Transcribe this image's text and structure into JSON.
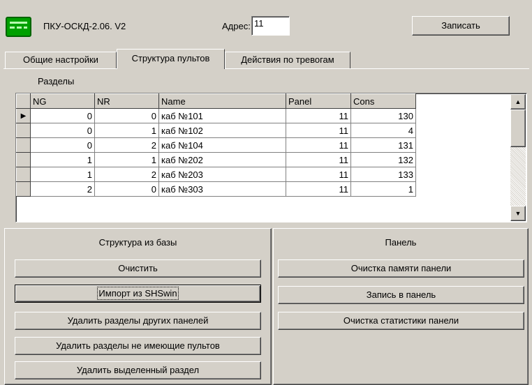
{
  "header": {
    "device_title": "ПКУ-ОСКД-2.06. V2",
    "address_label": "Адрес:",
    "address_value": "11",
    "write_button": "Записать"
  },
  "tabs": [
    {
      "label": "Общие настройки",
      "active": false
    },
    {
      "label": "Структура пультов",
      "active": true
    },
    {
      "label": "Действия по тревогам",
      "active": false
    }
  ],
  "sections_label": "Разделы",
  "table": {
    "columns": [
      "NG",
      "NR",
      "Name",
      "Panel",
      "Cons"
    ],
    "rows": [
      {
        "NG": "0",
        "NR": "0",
        "Name": "каб №101",
        "Panel": "11",
        "Cons": "130",
        "current": true
      },
      {
        "NG": "0",
        "NR": "1",
        "Name": "каб №102",
        "Panel": "11",
        "Cons": "4",
        "current": false
      },
      {
        "NG": "0",
        "NR": "2",
        "Name": "каб №104",
        "Panel": "11",
        "Cons": "131",
        "current": false
      },
      {
        "NG": "1",
        "NR": "1",
        "Name": "каб №202",
        "Panel": "11",
        "Cons": "132",
        "current": false
      },
      {
        "NG": "1",
        "NR": "2",
        "Name": "каб №203",
        "Panel": "11",
        "Cons": "133",
        "current": false
      },
      {
        "NG": "2",
        "NR": "0",
        "Name": "каб №303",
        "Panel": "11",
        "Cons": "1",
        "current": false
      }
    ]
  },
  "left_panel": {
    "caption": "Структура из базы",
    "buttons": [
      "Очистить",
      "Импорт из SHSwin",
      "Удалить разделы других панелей",
      "Удалить разделы не имеющие пультов",
      "Удалить выделенный раздел"
    ]
  },
  "right_panel": {
    "caption": "Панель",
    "buttons": [
      "Очистка памяти панели",
      "Запись в панель",
      "Очистка статистики панели"
    ]
  },
  "icons": {
    "device": "device-icon",
    "row_pointer": "row-pointer-icon",
    "scroll_up": "scroll-up-arrow-icon",
    "scroll_down": "scroll-down-arrow-icon"
  },
  "colors": {
    "window_bg": "#d4d0c8",
    "device_icon": "#00a000"
  }
}
